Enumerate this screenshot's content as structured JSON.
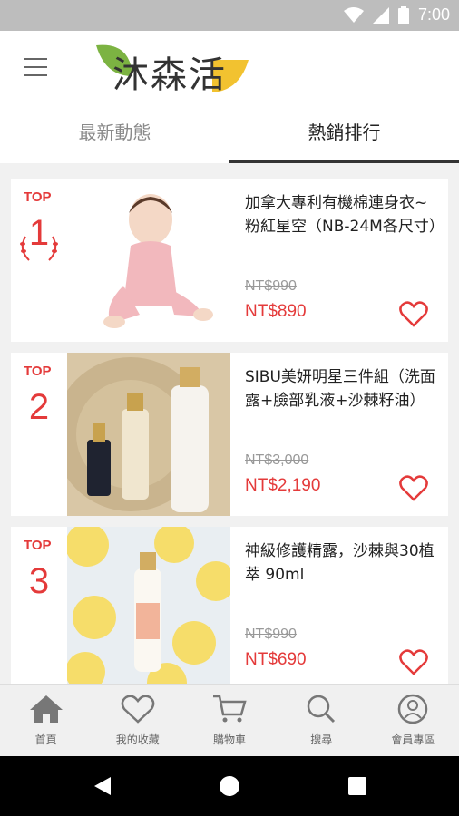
{
  "status_bar": {
    "time": "7:00"
  },
  "app": {
    "logo_text": "沐森活"
  },
  "tabs": [
    {
      "label": "最新動態",
      "active": false
    },
    {
      "label": "熱銷排行",
      "active": true
    }
  ],
  "products": [
    {
      "rank_label": "TOP",
      "rank": "1",
      "title": "加拿大專利有機棉連身衣~粉紅星空（NB-24M各尺寸）",
      "original_price": "NT$990",
      "sale_price": "NT$890",
      "image": "baby-in-pink-onesie"
    },
    {
      "rank_label": "TOP",
      "rank": "2",
      "title": "SIBU美妍明星三件組（洗面露+臉部乳液+沙棘籽油）",
      "original_price": "NT$3,000",
      "sale_price": "NT$2,190",
      "image": "skincare-bottles"
    },
    {
      "rank_label": "TOP",
      "rank": "3",
      "title": "神級修護精露，沙棘與30植萃 90ml",
      "original_price": "NT$990",
      "sale_price": "NT$690",
      "image": "bottle-with-lemon-slices"
    }
  ],
  "bottom_nav": [
    {
      "label": "首頁",
      "icon": "home-icon"
    },
    {
      "label": "我的收藏",
      "icon": "heart-icon"
    },
    {
      "label": "購物車",
      "icon": "cart-icon"
    },
    {
      "label": "搜尋",
      "icon": "search-icon"
    },
    {
      "label": "會員專區",
      "icon": "user-icon"
    }
  ],
  "colors": {
    "accent": "#e43a3a",
    "logo_green": "#7cb342",
    "logo_yellow": "#f2c230"
  }
}
